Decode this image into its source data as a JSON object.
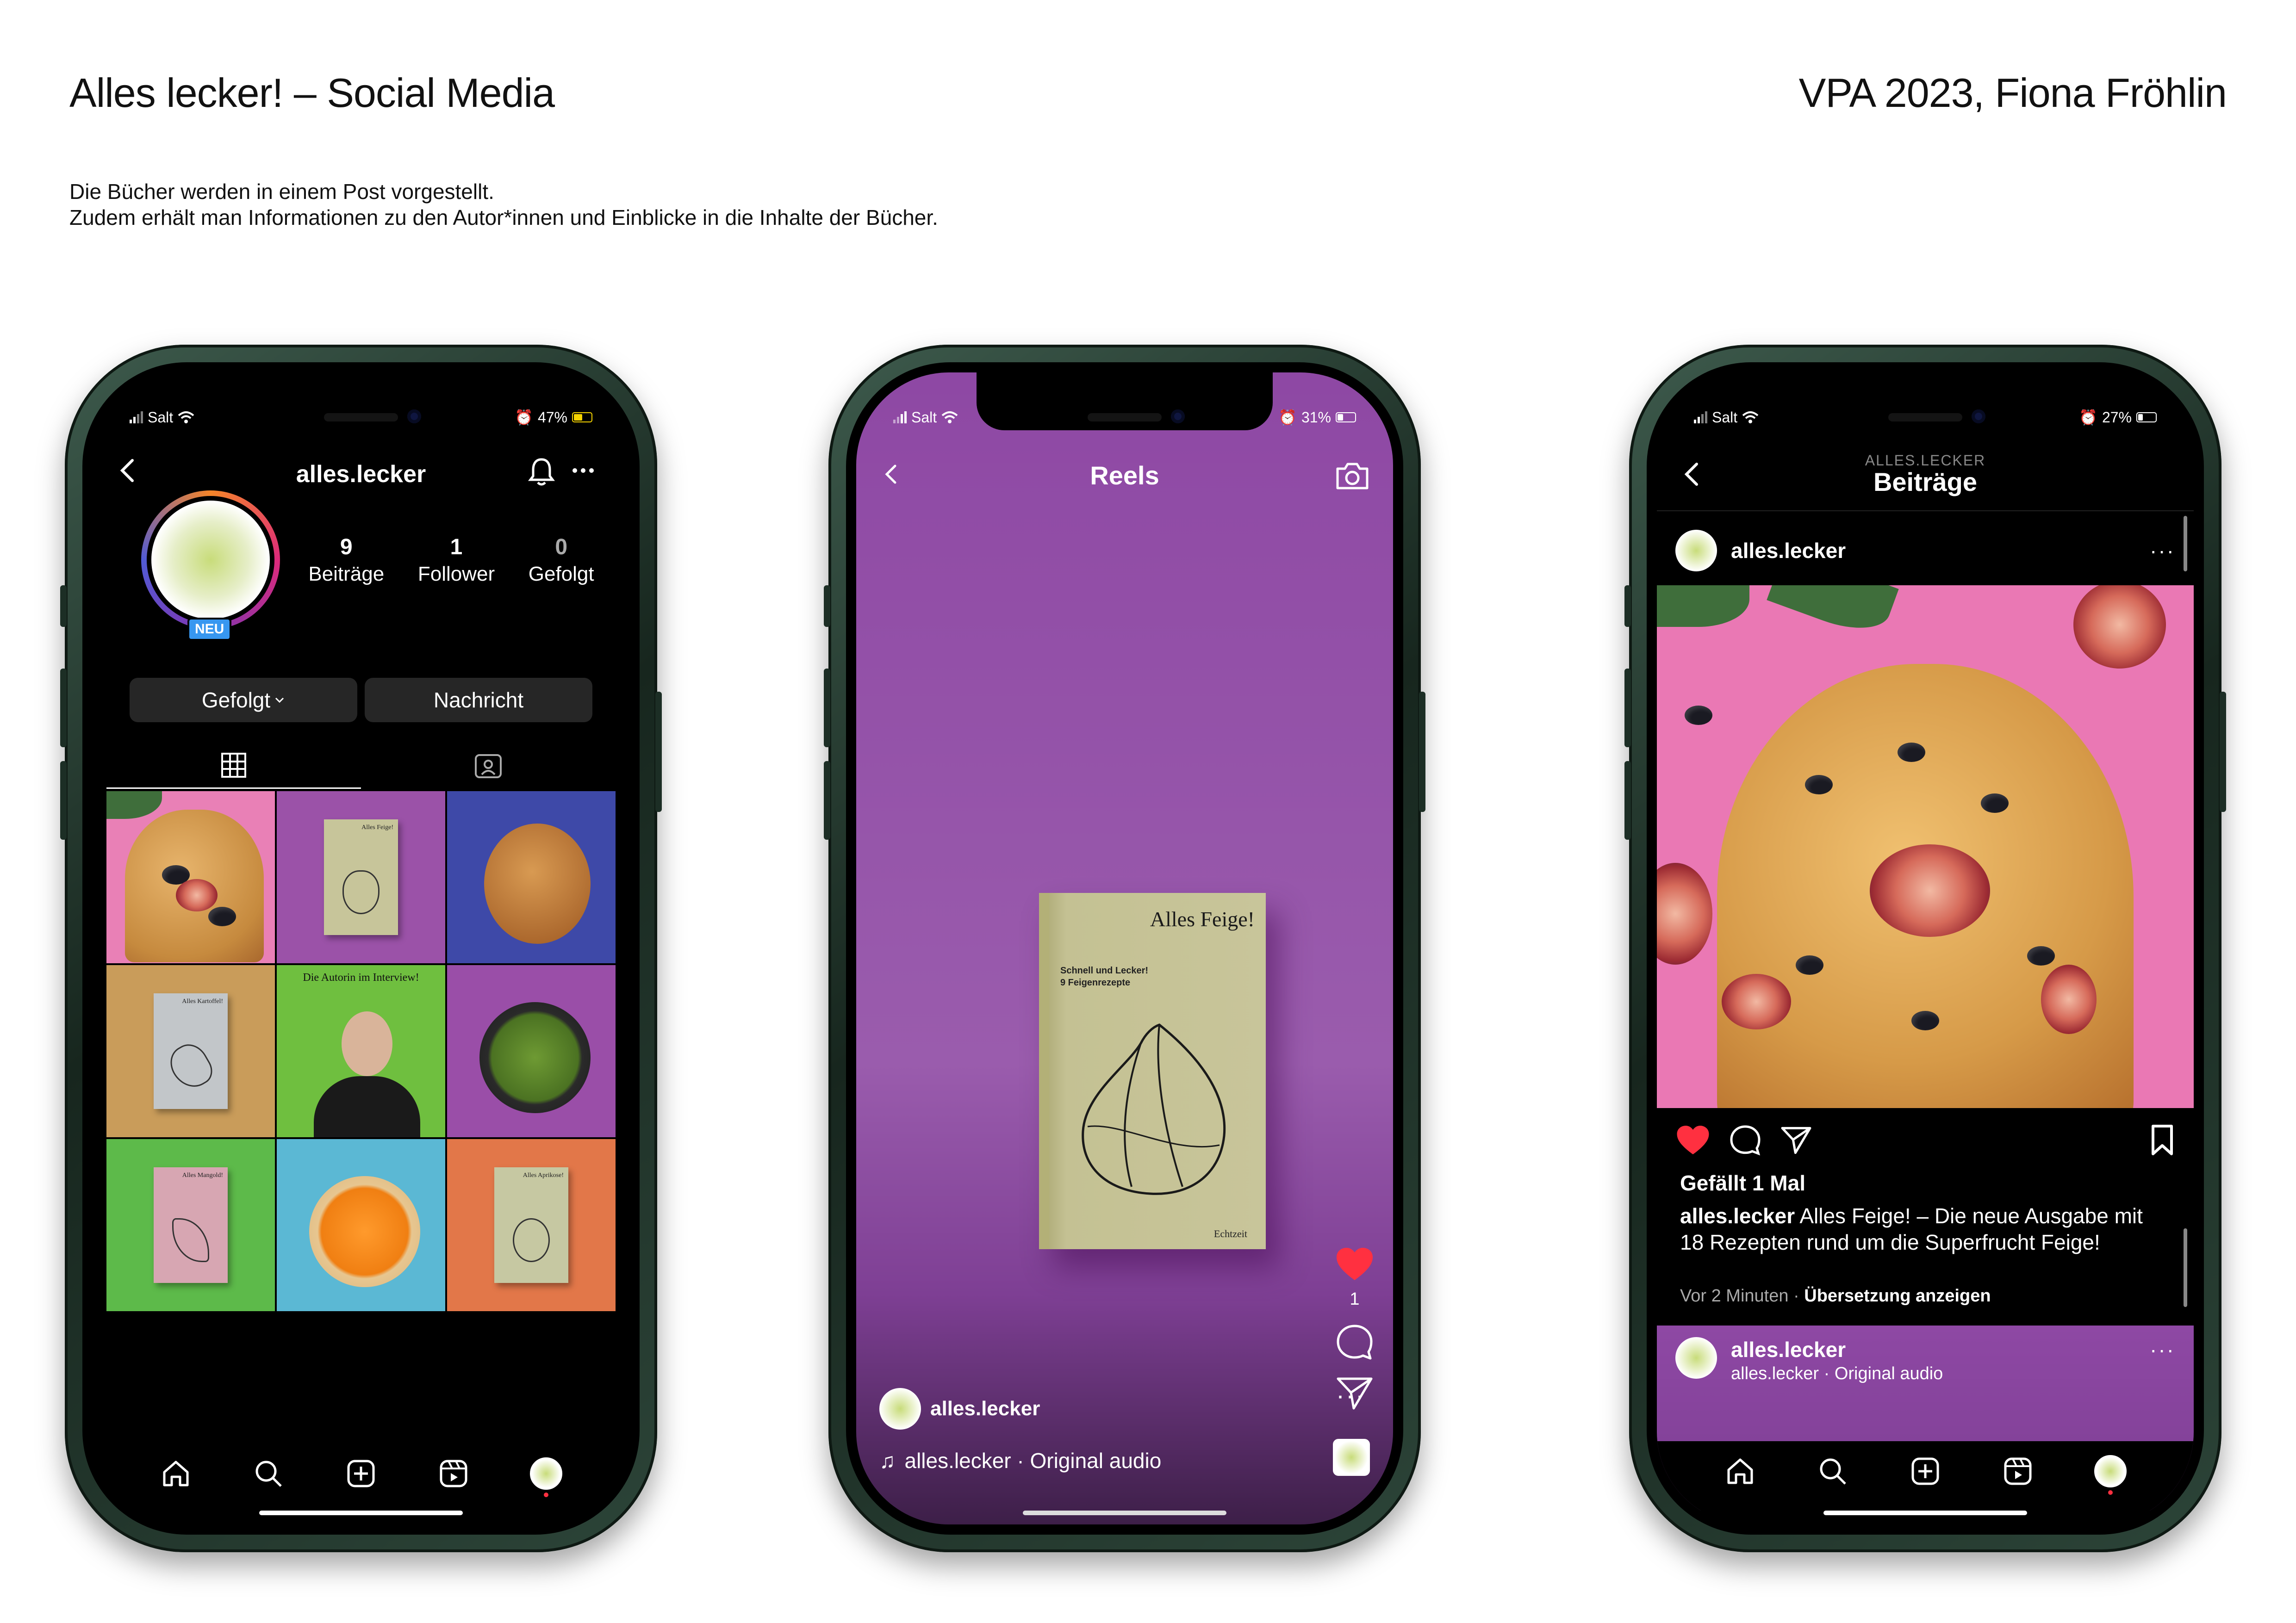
{
  "page": {
    "title": "Alles lecker! – Social Media",
    "credit": "VPA 2023, Fiona Fröhlin",
    "description_line1": "Die Bücher werden in einem Post vorgestellt.",
    "description_line2": "Zudem erhält man Informationen zu den Autor*innen und Einblicke in die Inhalte der Bücher."
  },
  "phone1": {
    "status": {
      "carrier": "Salt",
      "battery": "47%",
      "battery_level": 0.47
    },
    "header": {
      "username": "alles.lecker"
    },
    "profile": {
      "badge": "NEU",
      "stats": [
        {
          "value": "9",
          "label": "Beiträge"
        },
        {
          "value": "1",
          "label": "Follower"
        },
        {
          "value": "0",
          "label": "Gefolgt"
        }
      ],
      "follow_button": "Gefolgt",
      "message_button": "Nachricht"
    },
    "grid": {
      "book1_title": "Alles Feige!",
      "interview_caption": "Die Autorin im Interview!",
      "book2_title": "Alles Kartoffel!",
      "book3_title": "Alles Mangold!",
      "book4_title": "Alles Aprikose!"
    },
    "nav": [
      "home-icon",
      "search-icon",
      "create-icon",
      "reels-icon",
      "profile-avatar"
    ]
  },
  "phone2": {
    "status": {
      "carrier": "Salt",
      "battery": "31%",
      "battery_level": 0.31
    },
    "header": {
      "title": "Reels"
    },
    "book": {
      "title": "Alles Feige!",
      "subtitle_line1": "Schnell und Lecker!",
      "subtitle_line2": "9 Feigenrezepte",
      "publisher": "Echtzeit"
    },
    "likes_count": "1",
    "user": "alles.lecker",
    "audio": "alles.lecker · Original audio",
    "more": "···"
  },
  "phone3": {
    "status": {
      "carrier": "Salt",
      "battery": "27%",
      "battery_level": 0.27
    },
    "header": {
      "pre_title": "ALLES.LECKER",
      "title": "Beiträge"
    },
    "post": {
      "username": "alles.lecker",
      "more": "···",
      "likes": "Gefällt 1 Mal",
      "caption_user": "alles.lecker",
      "caption_text": " Alles Feige! – Die neue Ausgabe mit 18 Rezepten rund um die Superfrucht Feige!",
      "time": "Vor 2 Minuten",
      "separator": " · ",
      "translate": "Übersetzung anzeigen"
    },
    "next": {
      "username": "alles.lecker",
      "audio": "alles.lecker · Original audio",
      "more": "···"
    }
  },
  "colors": {
    "reels_purple": "#8e48a4",
    "post_pink": "#ea78b4",
    "like_red": "#ff3040",
    "badge_blue": "#3797f0",
    "phone_green": "#17261e"
  }
}
